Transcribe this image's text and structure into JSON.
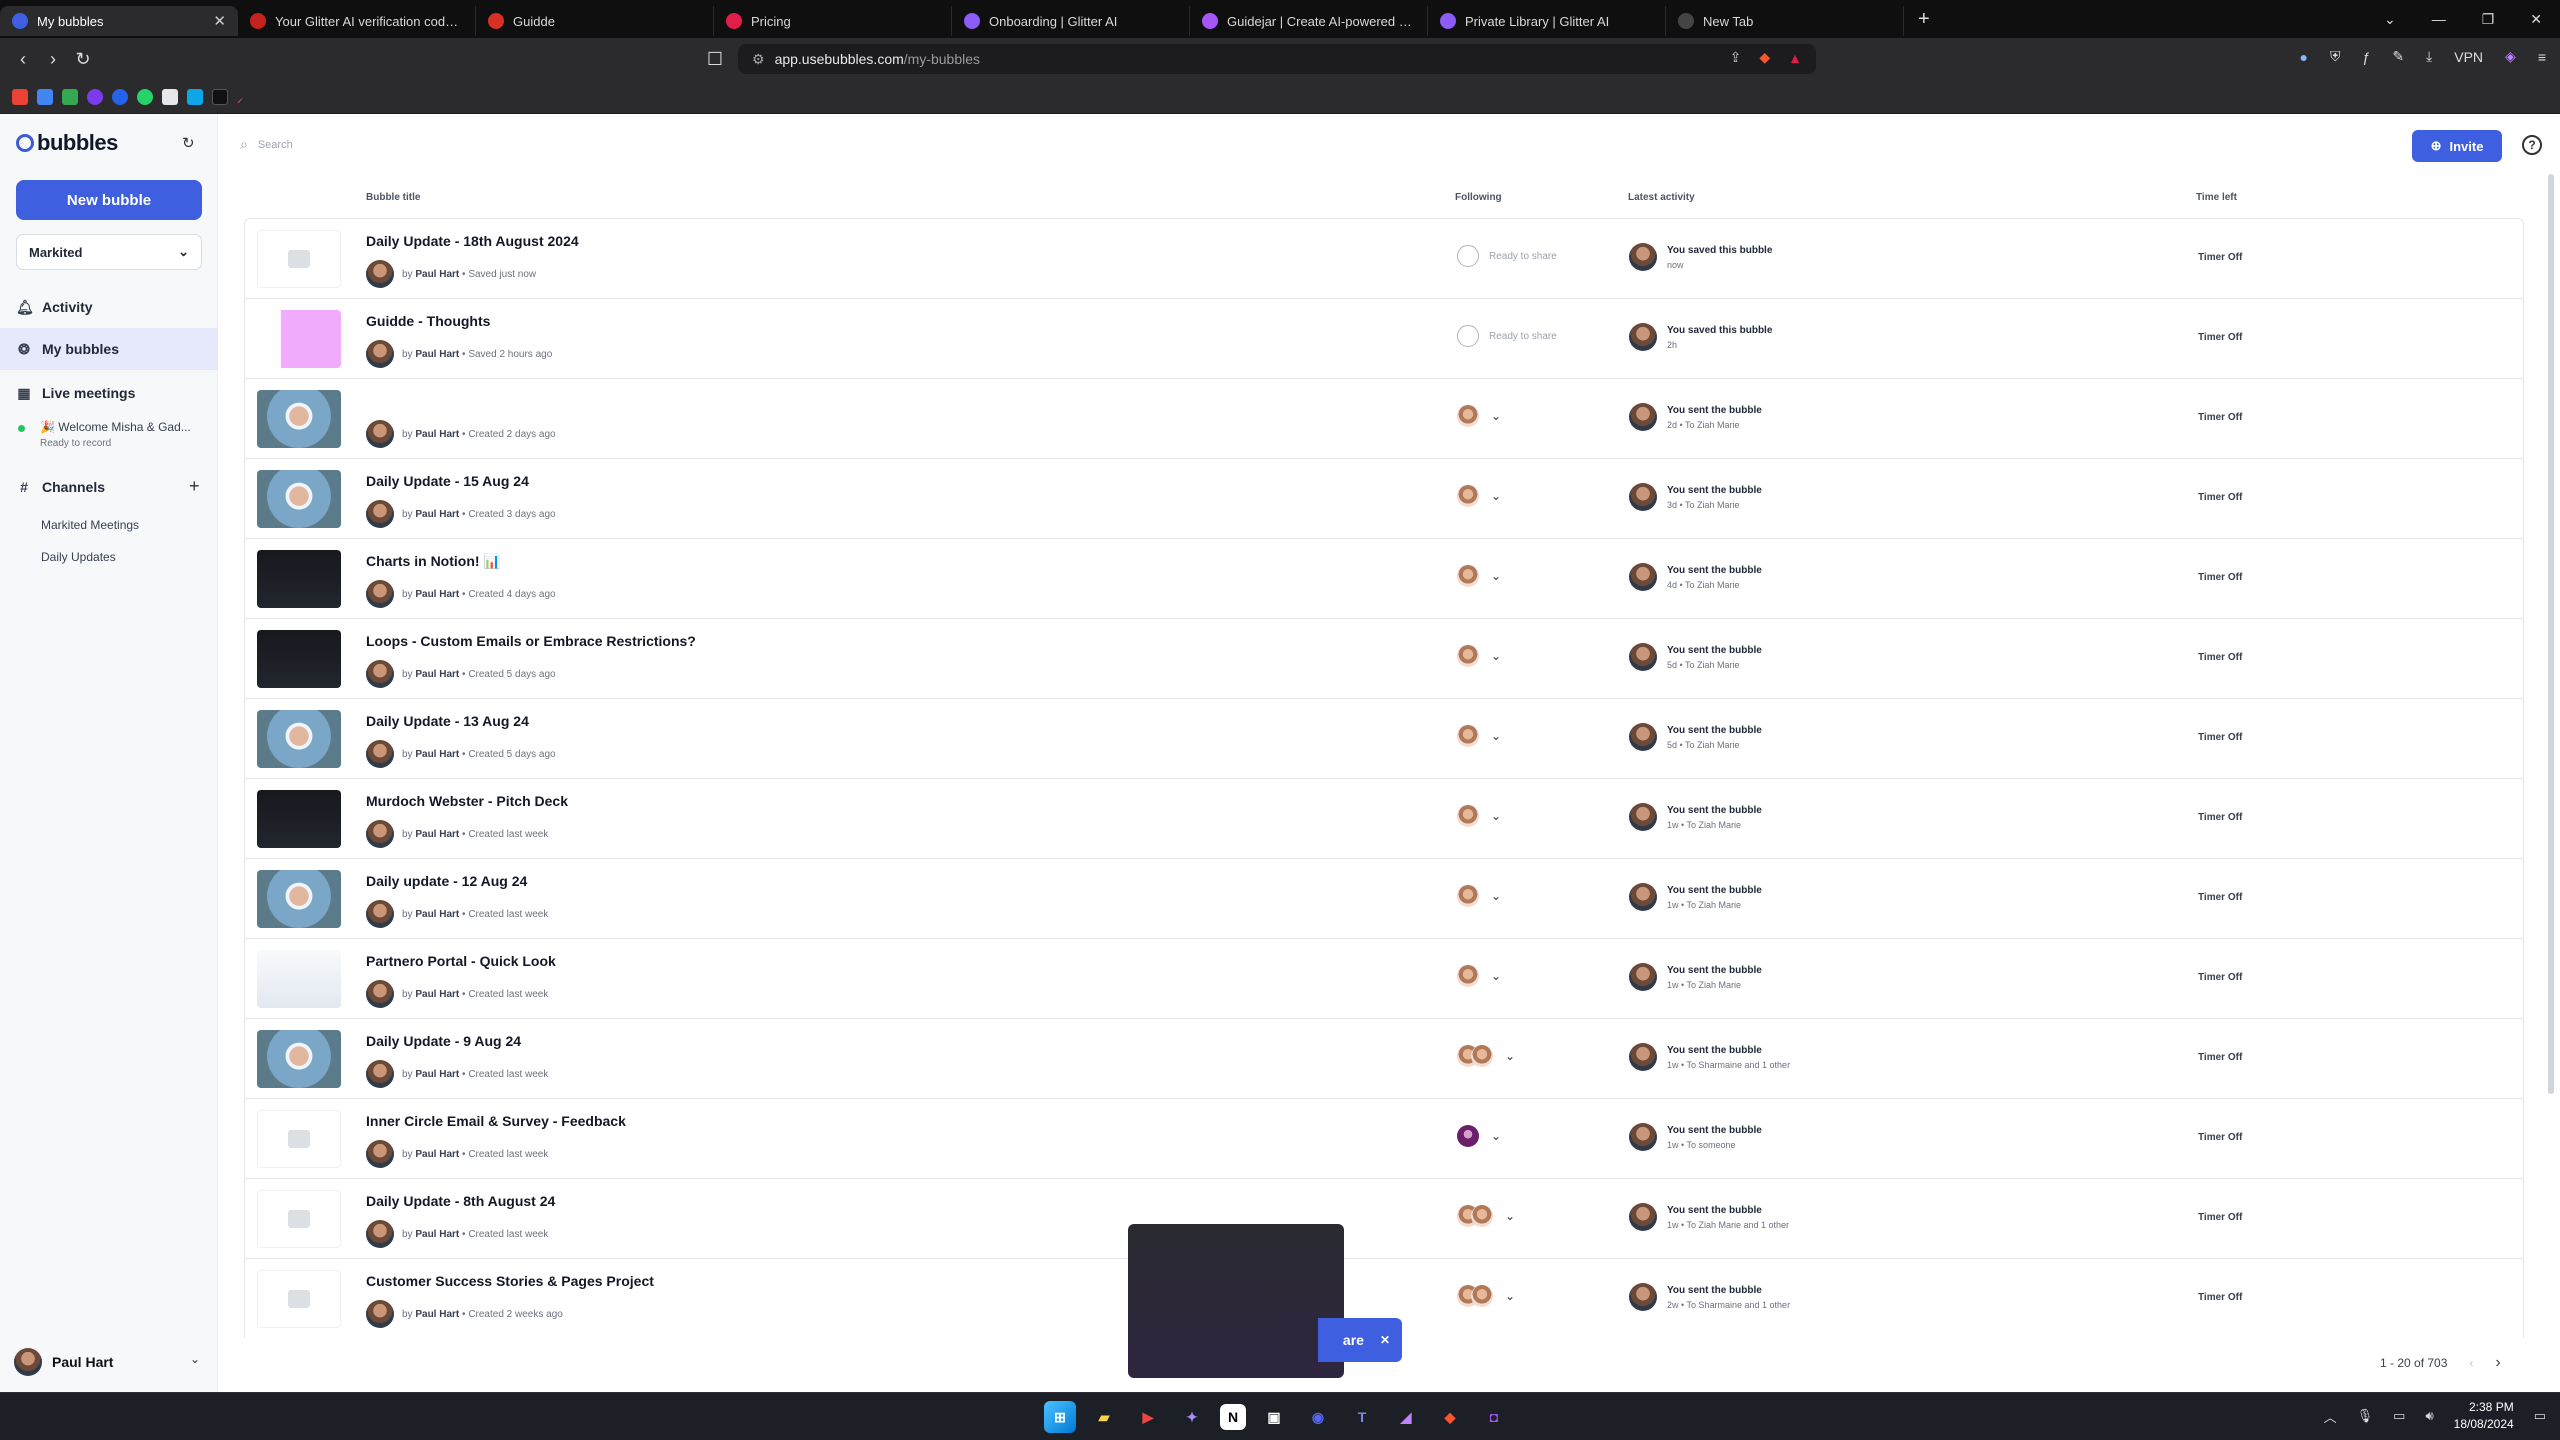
{
  "browser": {
    "tabs": [
      {
        "title": "My bubbles",
        "color": "#3d5fe0",
        "active": true
      },
      {
        "title": "Your Glitter AI verification code - pa",
        "color": "#c5221f",
        "active": false
      },
      {
        "title": "Guidde",
        "color": "#d93025",
        "active": false
      },
      {
        "title": "Pricing",
        "color": "#e11d48",
        "active": false
      },
      {
        "title": "Onboarding | Glitter AI",
        "color": "#8b5cf6",
        "active": false
      },
      {
        "title": "Guidejar | Create AI-powered step-b",
        "color": "#a855f7",
        "active": false
      },
      {
        "title": "Private Library | Glitter AI",
        "color": "#8b5cf6",
        "active": false
      },
      {
        "title": "New Tab",
        "color": "#444444",
        "active": false
      }
    ],
    "url_host": "app.usebubbles.com",
    "url_path": "/my-bubbles",
    "vpn_label": "VPN"
  },
  "sidebar": {
    "logo": "bubbles",
    "new_bubble": "New bubble",
    "workspace": "Markited",
    "nav": {
      "activity": "Activity",
      "my_bubbles": "My bubbles",
      "live_meetings": "Live meetings",
      "channels": "Channels"
    },
    "live_meeting": {
      "name": "🎉 Welcome Misha & Gad...",
      "status": "Ready to record"
    },
    "channel_items": [
      "Markited Meetings",
      "Daily Updates"
    ],
    "user": "Paul Hart"
  },
  "main": {
    "search_placeholder": "Search",
    "invite": "Invite",
    "columns": {
      "title": "Bubble title",
      "following": "Following",
      "latest": "Latest activity",
      "time": "Time left"
    },
    "rows": [
      {
        "title": "Daily Update - 18th August 2024",
        "author": "Paul Hart",
        "meta": "Saved just now",
        "thumb": "empty",
        "follow": "ready",
        "ready_label": "Ready to share",
        "act1": "You saved this bubble",
        "act2": "now",
        "timer": "Timer Off"
      },
      {
        "title": "Guidde - Thoughts",
        "author": "Paul Hart",
        "meta": "Saved 2 hours ago",
        "thumb": "screen-pink",
        "follow": "ready",
        "ready_label": "Ready to share",
        "act1": "You saved this bubble",
        "act2": "2h",
        "timer": "Timer Off"
      },
      {
        "title": "",
        "author": "Paul Hart",
        "meta": "Created 2 days ago",
        "thumb": "face",
        "follow": "one",
        "act1": "You sent the bubble",
        "act2": "2d • To Ziah Marie",
        "timer": "Timer Off"
      },
      {
        "title": "Daily Update - 15 Aug 24",
        "author": "Paul Hart",
        "meta": "Created 3 days ago",
        "thumb": "face",
        "follow": "one",
        "act1": "You sent the bubble",
        "act2": "3d • To Ziah Marie",
        "timer": "Timer Off"
      },
      {
        "title": "Charts in Notion! 📊",
        "author": "Paul Hart",
        "meta": "Created 4 days ago",
        "thumb": "dark",
        "follow": "one",
        "act1": "You sent the bubble",
        "act2": "4d • To Ziah Marie",
        "timer": "Timer Off"
      },
      {
        "title": "Loops - Custom Emails or Embrace Restrictions?",
        "author": "Paul Hart",
        "meta": "Created 5 days ago",
        "thumb": "dark",
        "follow": "one",
        "act1": "You sent the bubble",
        "act2": "5d • To Ziah Marie",
        "timer": "Timer Off"
      },
      {
        "title": "Daily Update - 13 Aug 24",
        "author": "Paul Hart",
        "meta": "Created 5 days ago",
        "thumb": "face",
        "follow": "one",
        "act1": "You sent the bubble",
        "act2": "5d • To Ziah Marie",
        "timer": "Timer Off"
      },
      {
        "title": "Murdoch Webster - Pitch Deck",
        "author": "Paul Hart",
        "meta": "Created last week",
        "thumb": "dark",
        "follow": "one",
        "act1": "You sent the bubble",
        "act2": "1w • To Ziah Marie",
        "timer": "Timer Off"
      },
      {
        "title": "Daily update - 12 Aug 24",
        "author": "Paul Hart",
        "meta": "Created last week",
        "thumb": "face",
        "follow": "one",
        "act1": "You sent the bubble",
        "act2": "1w • To Ziah Marie",
        "timer": "Timer Off"
      },
      {
        "title": "Partnero Portal - Quick Look",
        "author": "Paul Hart",
        "meta": "Created last week",
        "thumb": "screen-light",
        "follow": "one",
        "act1": "You sent the bubble",
        "act2": "1w • To Ziah Marie",
        "timer": "Timer Off"
      },
      {
        "title": "Daily Update - 9 Aug 24",
        "author": "Paul Hart",
        "meta": "Created last week",
        "thumb": "face",
        "follow": "two",
        "act1": "You sent the bubble",
        "act2": "1w • To Sharmaine and 1 other",
        "timer": "Timer Off"
      },
      {
        "title": "Inner Circle Email & Survey - Feedback",
        "author": "Paul Hart",
        "meta": "Created last week",
        "thumb": "empty",
        "follow": "purple",
        "act1": "You sent the bubble",
        "act2": "1w • To someone",
        "timer": "Timer Off"
      },
      {
        "title": "Daily Update - 8th August 24",
        "author": "Paul Hart",
        "meta": "Created last week",
        "thumb": "empty",
        "follow": "two",
        "act1": "You sent the bubble",
        "act2": "1w • To Ziah Marie and 1 other",
        "timer": "Timer Off"
      },
      {
        "title": "Customer Success Stories & Pages Project",
        "author": "Paul Hart",
        "meta": "Created 2 weeks ago",
        "thumb": "empty",
        "follow": "two",
        "act1": "You sent the bubble",
        "act2": "2w • To Sharmaine and 1 other",
        "timer": "Timer Off"
      }
    ],
    "by_prefix": "by",
    "pager": "1 - 20 of 703"
  },
  "toast": {
    "label": "are"
  },
  "taskbar": {
    "time": "2:38 PM",
    "date": "18/08/2024"
  }
}
